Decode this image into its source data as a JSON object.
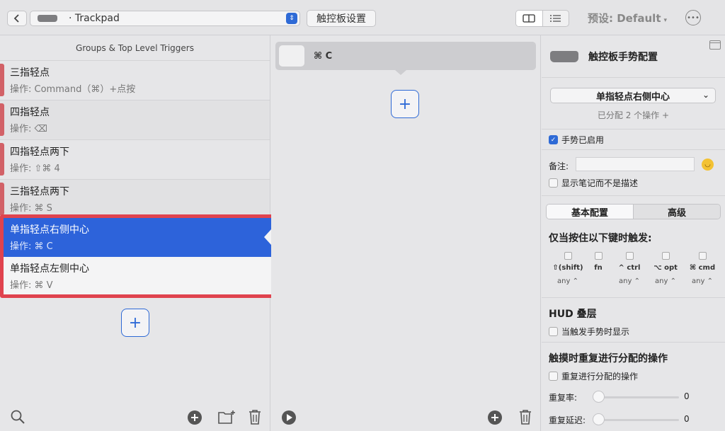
{
  "toolbar": {
    "device": "· Trackpad",
    "settings_button": "触控板设置",
    "preset": "预设: Default",
    "preset_caret": "▾"
  },
  "left_panel": {
    "header": "Groups & Top Level Triggers",
    "triggers": [
      {
        "title": "三指轻点",
        "action": "操作: Command（⌘）+点按"
      },
      {
        "title": "四指轻点",
        "action": "操作: ⌫"
      },
      {
        "title": "四指轻点两下",
        "action": "操作: ⇧⌘ 4"
      },
      {
        "title": "三指轻点两下",
        "action": "操作: ⌘ S"
      },
      {
        "title": "单指轻点右侧中心",
        "action": "操作: ⌘ C"
      },
      {
        "title": "单指轻点左侧中心",
        "action": "操作: ⌘ V"
      }
    ],
    "add_label": "+"
  },
  "middle_panel": {
    "action_label": "⌘ C",
    "add_label": "+"
  },
  "right_panel": {
    "title": "触控板手势配置",
    "gesture_select": "单指轻点右侧中心",
    "gesture_chevron": "⌄",
    "assigned": "已分配 2 个操作 +",
    "enabled_label": "手势已启用",
    "note_label": "备注:",
    "note_value": "",
    "show_note_label": "显示笔记而不是描述",
    "tab_basic": "基本配置",
    "tab_advanced": "高级",
    "modifiers_title": "仅当按住以下键时触发:",
    "modifiers": [
      {
        "name": "⇧(shift)",
        "value": "any ⌃"
      },
      {
        "name": "fn",
        "value": ""
      },
      {
        "name": "^ ctrl",
        "value": "any ⌃"
      },
      {
        "name": "⌥ opt",
        "value": "any ⌃"
      },
      {
        "name": "⌘ cmd",
        "value": "any ⌃"
      }
    ],
    "hud_title": "HUD 叠层",
    "hud_label": "当触发手势时显示",
    "repeat_title": "触摸时重复进行分配的操作",
    "repeat_label": "重复进行分配的操作",
    "repeat_rate_label": "重复率:",
    "repeat_rate_value": "0",
    "repeat_delay_label": "重复延迟:",
    "repeat_delay_value": "0"
  }
}
